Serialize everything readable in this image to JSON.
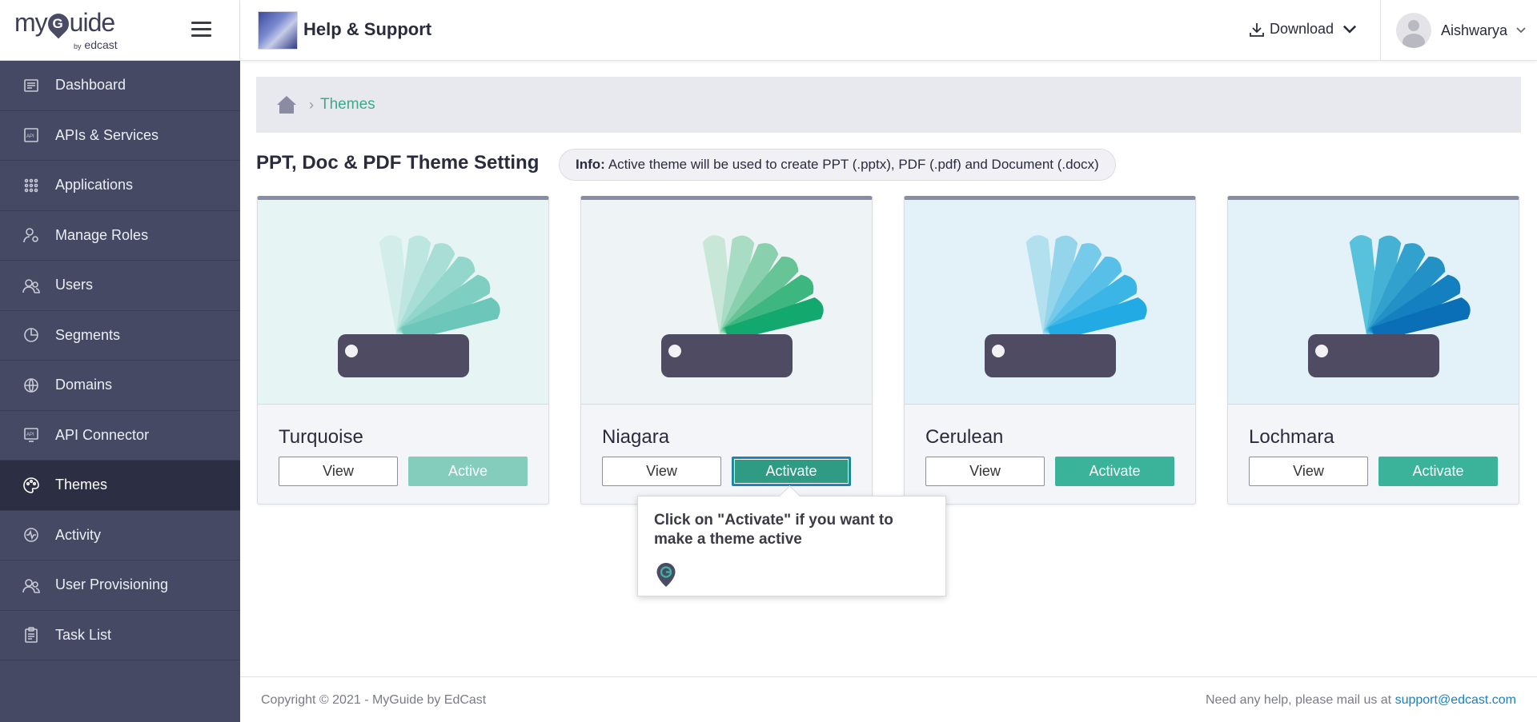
{
  "brand": {
    "logo_prefix": "my",
    "logo_suffix": "uide",
    "logo_by": "by",
    "logo_company": "edcast"
  },
  "header": {
    "app_title": "Help & Support",
    "download_label": "Download",
    "user_name": "Aishwarya"
  },
  "sidebar": {
    "items": [
      {
        "label": "Dashboard",
        "icon": "dashboard-icon"
      },
      {
        "label": "APIs & Services",
        "icon": "api-icon"
      },
      {
        "label": "Applications",
        "icon": "grid-icon"
      },
      {
        "label": "Manage Roles",
        "icon": "user-gear-icon"
      },
      {
        "label": "Users",
        "icon": "users-icon"
      },
      {
        "label": "Segments",
        "icon": "pie-icon"
      },
      {
        "label": "Domains",
        "icon": "globe-icon"
      },
      {
        "label": "API Connector",
        "icon": "api-connector-icon"
      },
      {
        "label": "Themes",
        "icon": "palette-icon",
        "active": true
      },
      {
        "label": "Activity",
        "icon": "activity-icon"
      },
      {
        "label": "User Provisioning",
        "icon": "users-icon"
      },
      {
        "label": "Task List",
        "icon": "clipboard-icon"
      }
    ]
  },
  "breadcrumb": {
    "current": "Themes"
  },
  "main": {
    "title": "PPT, Doc & PDF Theme Setting",
    "info_label": "Info:",
    "info_text": "Active theme will be used to create PPT (.pptx), PDF (.pdf) and Document (.docx)"
  },
  "themes": [
    {
      "name": "Turquoise",
      "view_label": "View",
      "action_label": "Active",
      "state": "active",
      "bg": "#e6f4f3",
      "colors": [
        "#d3eeea",
        "#bde6e0",
        "#a8ded6",
        "#93d6cc",
        "#7ecec2",
        "#6cc6b9"
      ]
    },
    {
      "name": "Niagara",
      "view_label": "View",
      "action_label": "Activate",
      "state": "focused",
      "bg": "#eef3f5",
      "colors": [
        "#c9e7d9",
        "#a9dcc4",
        "#88d0ae",
        "#66c497",
        "#3db77f",
        "#12a86e"
      ]
    },
    {
      "name": "Cerulean",
      "view_label": "View",
      "action_label": "Activate",
      "state": "normal",
      "bg": "#e3f2f9",
      "colors": [
        "#b3e0ef",
        "#95d5ec",
        "#77cbea",
        "#58c0e8",
        "#3bb5e6",
        "#21aae3"
      ]
    },
    {
      "name": "Lochmara",
      "view_label": "View",
      "action_label": "Activate",
      "state": "normal",
      "bg": "#e3f2f9",
      "colors": [
        "#58c2dc",
        "#45b2d5",
        "#33a1ce",
        "#2391c6",
        "#1480bf",
        "#0a6fb6"
      ]
    }
  ],
  "tooltip": {
    "text": "Click on \"Activate\" if you want to make a theme active"
  },
  "footer": {
    "copyright": "Copyright © 2021 - MyGuide by EdCast",
    "help_text": "Need any help, please mail us at ",
    "help_email": "support@edcast.com"
  },
  "colors": {
    "sidebar_bg": "#464963",
    "sidebar_active": "#2c2e43",
    "accent": "#3ab39a",
    "link": "#1a7fc1"
  }
}
